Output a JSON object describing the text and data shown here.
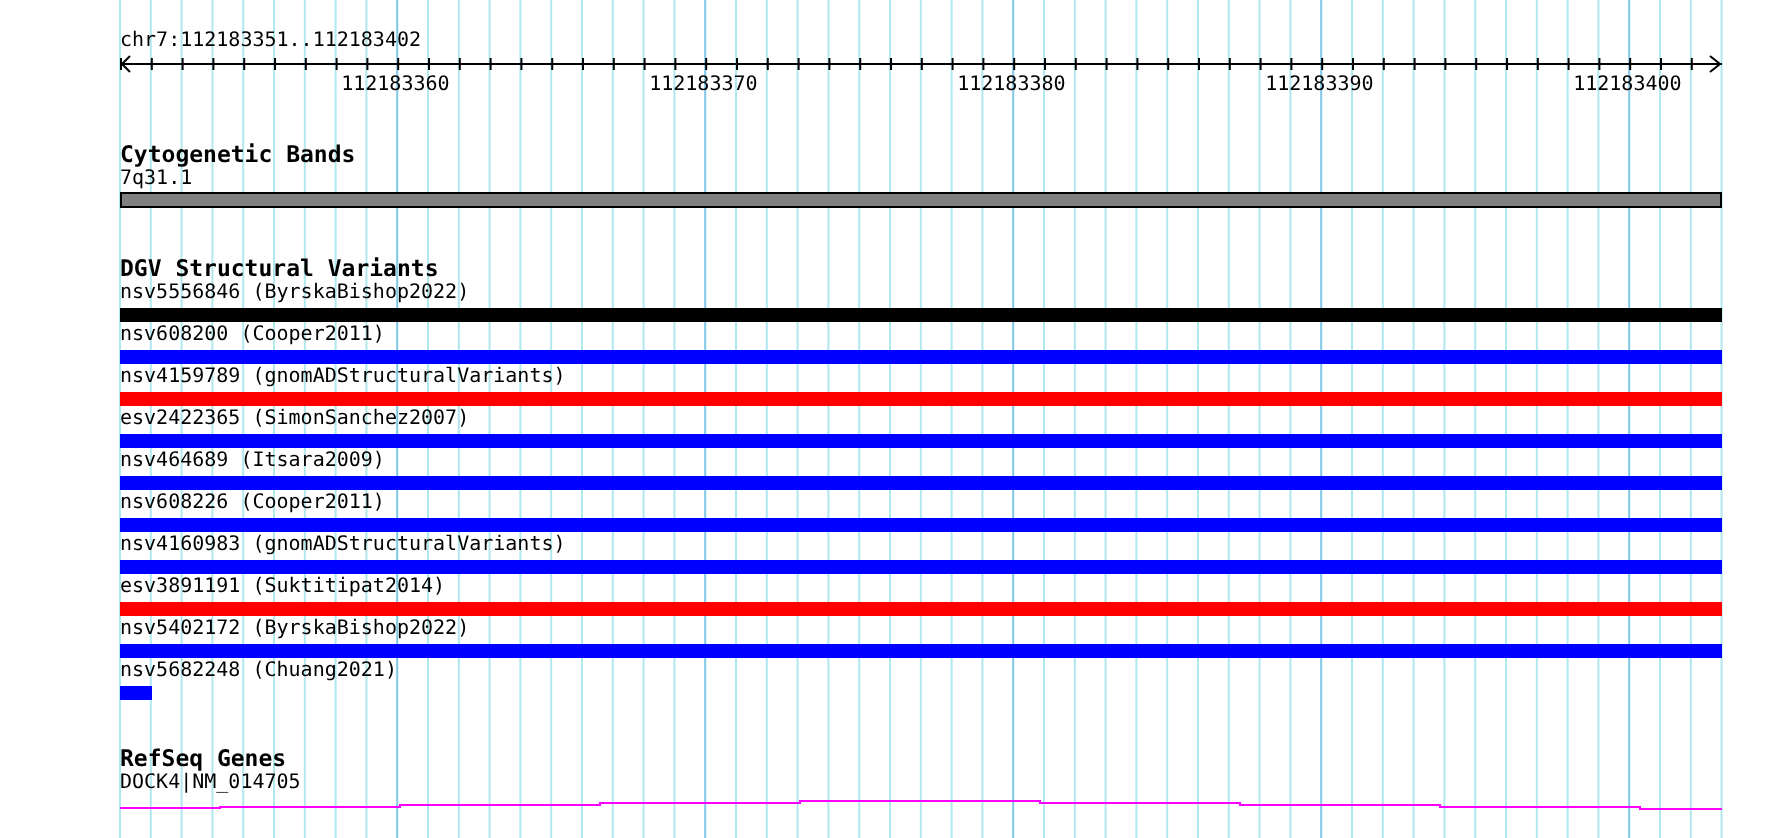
{
  "ruler": {
    "region": "chr7:112183351..112183402",
    "tick_labels": [
      "112183360",
      "112183370",
      "112183380",
      "112183390",
      "112183400"
    ]
  },
  "cytogenetic_bands": {
    "title": "Cytogenetic Bands",
    "band": "7q31.1"
  },
  "dgv_structural_variants": {
    "title": "DGV Structural Variants",
    "features": [
      {
        "label": "nsv5556846 (ByrskaBishop2022)",
        "color": "#000000",
        "kind": "full"
      },
      {
        "label": "nsv608200 (Cooper2011)",
        "color": "#0000ff",
        "kind": "full"
      },
      {
        "label": "nsv4159789 (gnomADStructuralVariants)",
        "color": "#ff0000",
        "kind": "full"
      },
      {
        "label": "esv2422365 (SimonSanchez2007)",
        "color": "#0000ff",
        "kind": "full"
      },
      {
        "label": "nsv464689 (Itsara2009)",
        "color": "#0000ff",
        "kind": "full"
      },
      {
        "label": "nsv608226 (Cooper2011)",
        "color": "#0000ff",
        "kind": "full"
      },
      {
        "label": "nsv4160983 (gnomADStructuralVariants)",
        "color": "#0000ff",
        "kind": "full"
      },
      {
        "label": "esv3891191 (Suktitipat2014)",
        "color": "#ff0000",
        "kind": "full"
      },
      {
        "label": "nsv5402172 (ByrskaBishop2022)",
        "color": "#0000ff",
        "kind": "full"
      },
      {
        "label": "nsv5682248 (Chuang2021)",
        "color": "#0000ff",
        "kind": "partial"
      }
    ]
  },
  "refseq_genes": {
    "title": "RefSeq Genes",
    "gene": "DOCK4|NM_014705"
  }
}
